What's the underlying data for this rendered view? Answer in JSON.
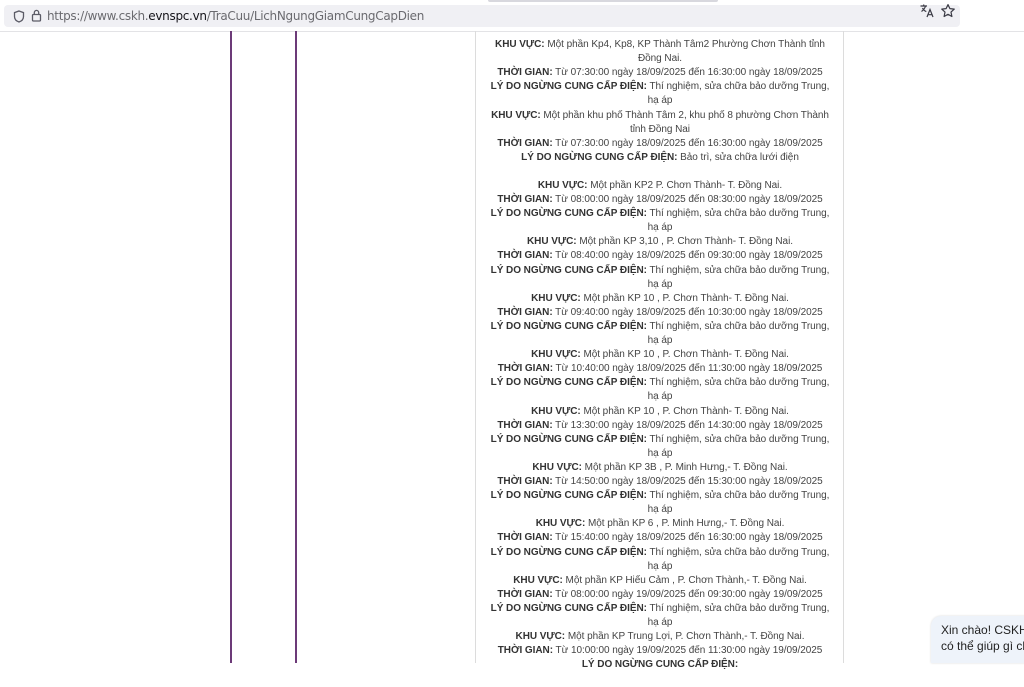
{
  "browser": {
    "url_prefix": "https://www.cskh.",
    "url_domain": "evnspc.vn",
    "url_path": "/TraCuu/LichNgungGiamCungCapDien"
  },
  "labels": {
    "area": "KHU VỰC:",
    "time": "THỜI GIAN:",
    "reason": "LÝ DO NGỪNG CUNG CẤP ĐIỆN:"
  },
  "outages": [
    {
      "area": "Một phần Kp4, Kp8, KP Thành Tâm2 Phường Chơn Thành tỉnh Đồng Nai.",
      "time": "Từ 07:30:00 ngày 18/09/2025 đến 16:30:00 ngày 18/09/2025",
      "reason": "Thí nghiệm, sửa chữa bảo dưỡng Trung, hạ áp"
    },
    {
      "area": "Một phần khu phố Thành Tâm 2, khu phố 8 phường Chơn Thành tỉnh Đồng Nai",
      "time": "Từ 07:30:00 ngày 18/09/2025 đến 16:30:00 ngày 18/09/2025",
      "reason": "Bảo trì, sửa chữa lưới điện"
    },
    {
      "area": "Một phần KP2 P. Chơn Thành- T. Đồng Nai.",
      "time": "Từ 08:00:00 ngày 18/09/2025 đến 08:30:00 ngày 18/09/2025",
      "reason": "Thí nghiệm, sửa chữa bảo dưỡng Trung, hạ áp"
    },
    {
      "area": "Một phần KP 3,10 , P. Chơn Thành- T. Đồng Nai.",
      "time": "Từ 08:40:00 ngày 18/09/2025 đến 09:30:00 ngày 18/09/2025",
      "reason": "Thí nghiệm, sửa chữa bảo dưỡng Trung, hạ áp"
    },
    {
      "area": "Một phần KP 10 , P. Chơn Thành- T. Đồng Nai.",
      "time": "Từ 09:40:00 ngày 18/09/2025 đến 10:30:00 ngày 18/09/2025",
      "reason": "Thí nghiệm, sửa chữa bảo dưỡng Trung, hạ áp"
    },
    {
      "area": "Một phần KP 10 , P. Chơn Thành- T. Đồng Nai.",
      "time": "Từ 10:40:00 ngày 18/09/2025 đến 11:30:00 ngày 18/09/2025",
      "reason": "Thí nghiệm, sửa chữa bảo dưỡng Trung, hạ áp"
    },
    {
      "area": "Một phần KP 10 , P. Chơn Thành- T. Đồng Nai.",
      "time": "Từ 13:30:00 ngày 18/09/2025 đến 14:30:00 ngày 18/09/2025",
      "reason": "Thí nghiệm, sửa chữa bảo dưỡng Trung, hạ áp"
    },
    {
      "area": "Một phần KP 3B , P. Minh Hưng,- T. Đồng Nai.",
      "time": "Từ 14:50:00 ngày 18/09/2025 đến 15:30:00 ngày 18/09/2025",
      "reason": "Thí nghiệm, sửa chữa bảo dưỡng Trung, hạ áp"
    },
    {
      "area": "Một phần KP 6 , P. Minh Hưng,- T. Đồng Nai.",
      "time": "Từ 15:40:00 ngày 18/09/2025 đến 16:30:00 ngày 18/09/2025",
      "reason": "Thí nghiệm, sửa chữa bảo dưỡng Trung, hạ áp"
    },
    {
      "area": "Một phần KP Hiếu Cảm , P. Chơn Thành,- T. Đồng Nai.",
      "time": "Từ 08:00:00 ngày 19/09/2025 đến 09:30:00 ngày 19/09/2025",
      "reason": "Thí nghiệm, sửa chữa bảo dưỡng Trung, hạ áp"
    },
    {
      "area": "Một phần KP Trung Lợi, P. Chơn Thành,- T. Đồng Nai.",
      "time": "Từ 10:00:00 ngày 19/09/2025 đến 11:30:00 ngày 19/09/2025",
      "reason": ""
    }
  ],
  "chat": {
    "line1": "Xin chào! CSKH I",
    "line2": "có thể giúp gì cho"
  }
}
